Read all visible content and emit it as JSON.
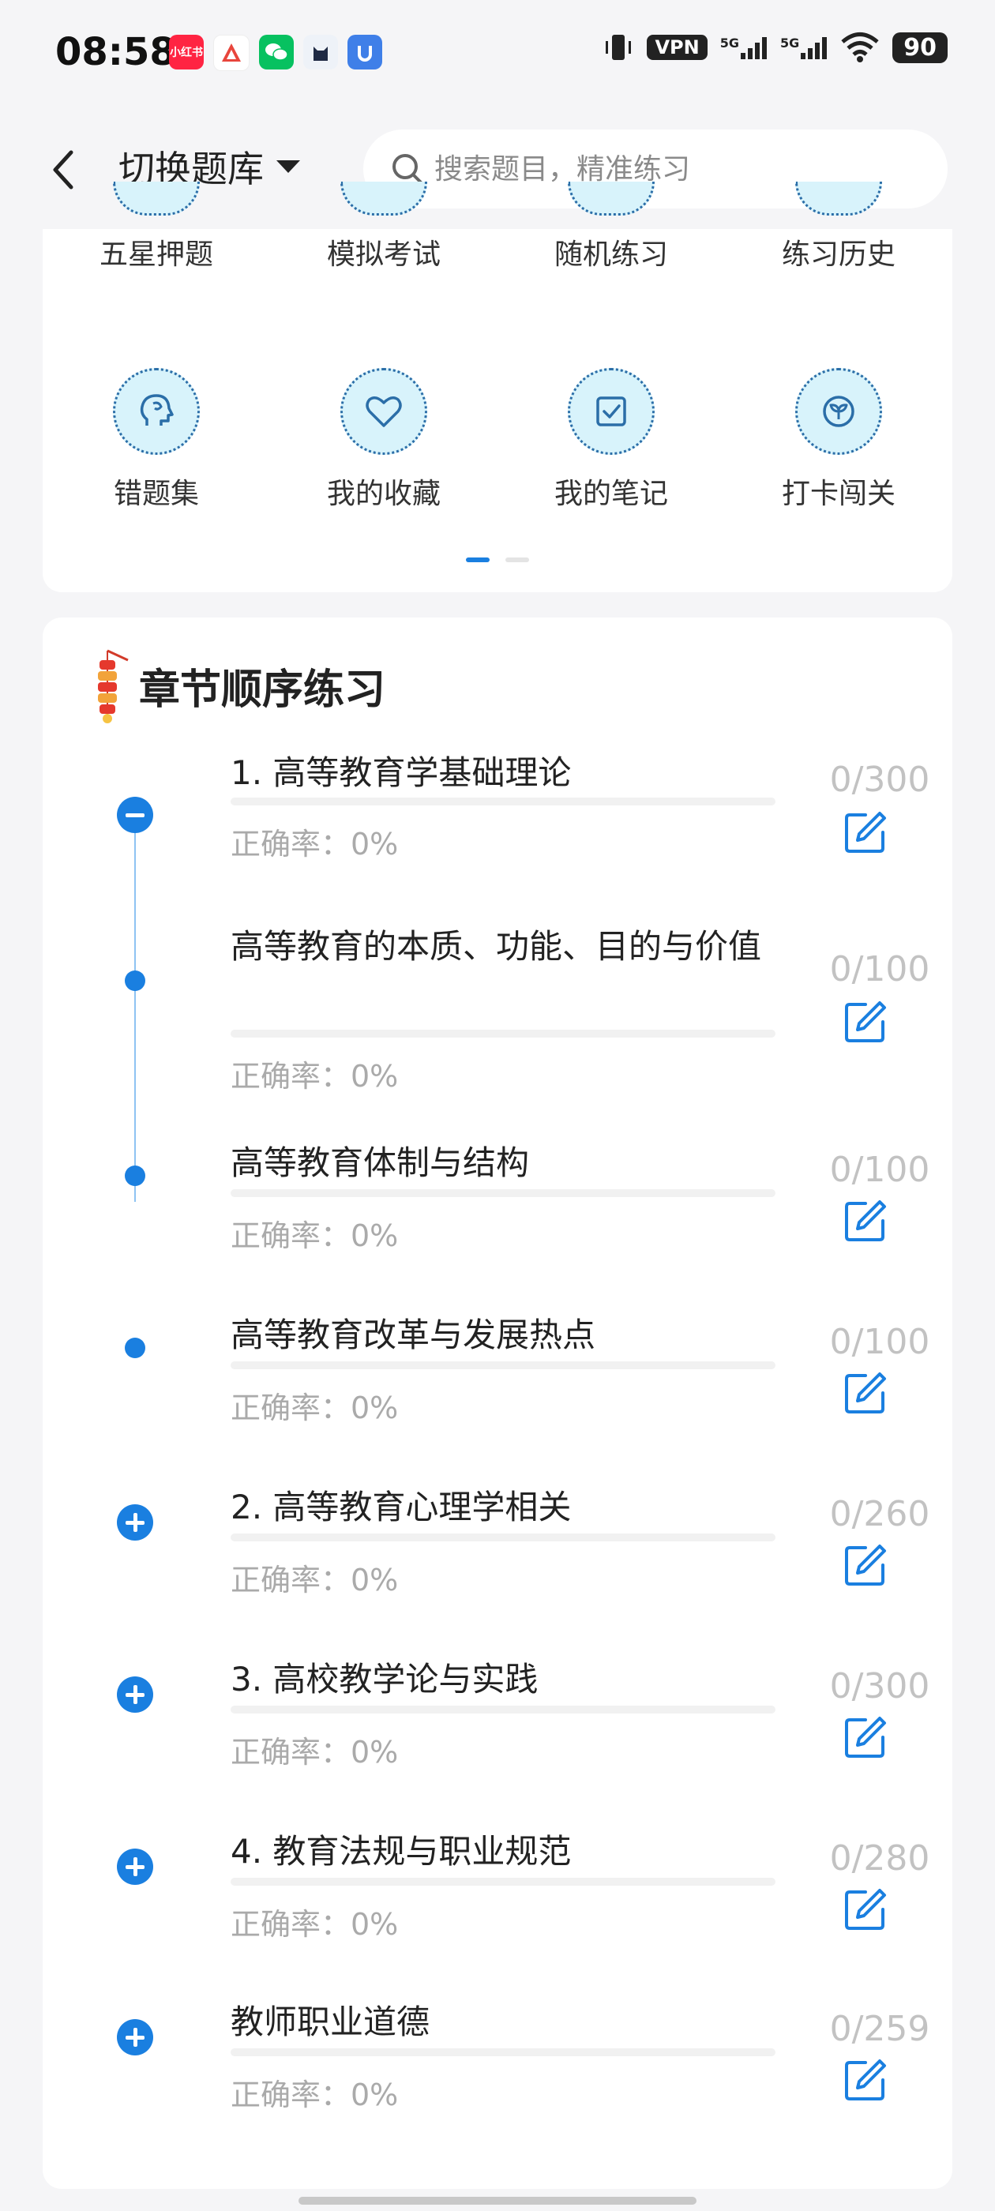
{
  "status_bar": {
    "time": "08:58",
    "app_icons": [
      {
        "name": "xiaohongshu",
        "label": "小红书",
        "color": "#ff2442"
      },
      {
        "name": "app-red",
        "label": "",
        "color": "#e8453c"
      },
      {
        "name": "wechat",
        "label": "",
        "color": "#07c160"
      },
      {
        "name": "app-dark",
        "label": "",
        "color": "#1f2a44"
      },
      {
        "name": "app-blue",
        "label": "",
        "color": "#3f7fe8"
      }
    ],
    "vpn": "VPN",
    "signal1": "5G",
    "signal2": "5G",
    "battery": "90"
  },
  "header": {
    "back_icon": "chevron-left-icon",
    "switch_label": "切换题库",
    "search_placeholder": "搜索题目，精准练习"
  },
  "menu": {
    "row1": [
      {
        "label": "五星押题",
        "icon": "star-icon"
      },
      {
        "label": "模拟考试",
        "icon": "exam-icon"
      },
      {
        "label": "随机练习",
        "icon": "shuffle-icon"
      },
      {
        "label": "练习历史",
        "icon": "history-icon"
      }
    ],
    "row2": [
      {
        "label": "错题集",
        "icon": "head-icon"
      },
      {
        "label": "我的收藏",
        "icon": "heart-icon"
      },
      {
        "label": "我的笔记",
        "icon": "note-check-icon"
      },
      {
        "label": "打卡闯关",
        "icon": "sprout-icon"
      }
    ],
    "pager_active": 0
  },
  "chapter": {
    "title": "章节顺序练习",
    "items": [
      {
        "title": "1. 高等教育学基础理论",
        "accuracy": "正确率：0%",
        "count": "0/300",
        "node": "minus"
      },
      {
        "title": "高等教育的本质、功能、目的与价值",
        "accuracy": "正确率：0%",
        "count": "0/100",
        "node": "dot"
      },
      {
        "title": "高等教育体制与结构",
        "accuracy": "正确率：0%",
        "count": "0/100",
        "node": "dot"
      },
      {
        "title": "高等教育改革与发展热点",
        "accuracy": "正确率：0%",
        "count": "0/100",
        "node": "dot"
      },
      {
        "title": "2. 高等教育心理学相关",
        "accuracy": "正确率：0%",
        "count": "0/260",
        "node": "plus"
      },
      {
        "title": "3. 高校教学论与实践",
        "accuracy": "正确率：0%",
        "count": "0/300",
        "node": "plus"
      },
      {
        "title": "4. 教育法规与职业规范",
        "accuracy": "正确率：0%",
        "count": "0/280",
        "node": "plus"
      },
      {
        "title": "教师职业道德",
        "accuracy": "正确率：0%",
        "count": "0/259",
        "node": "plus"
      }
    ]
  },
  "colors": {
    "accent": "#1a7fe0",
    "icon_bg": "#d8f3fb",
    "icon_stroke": "#2b6ea8"
  }
}
